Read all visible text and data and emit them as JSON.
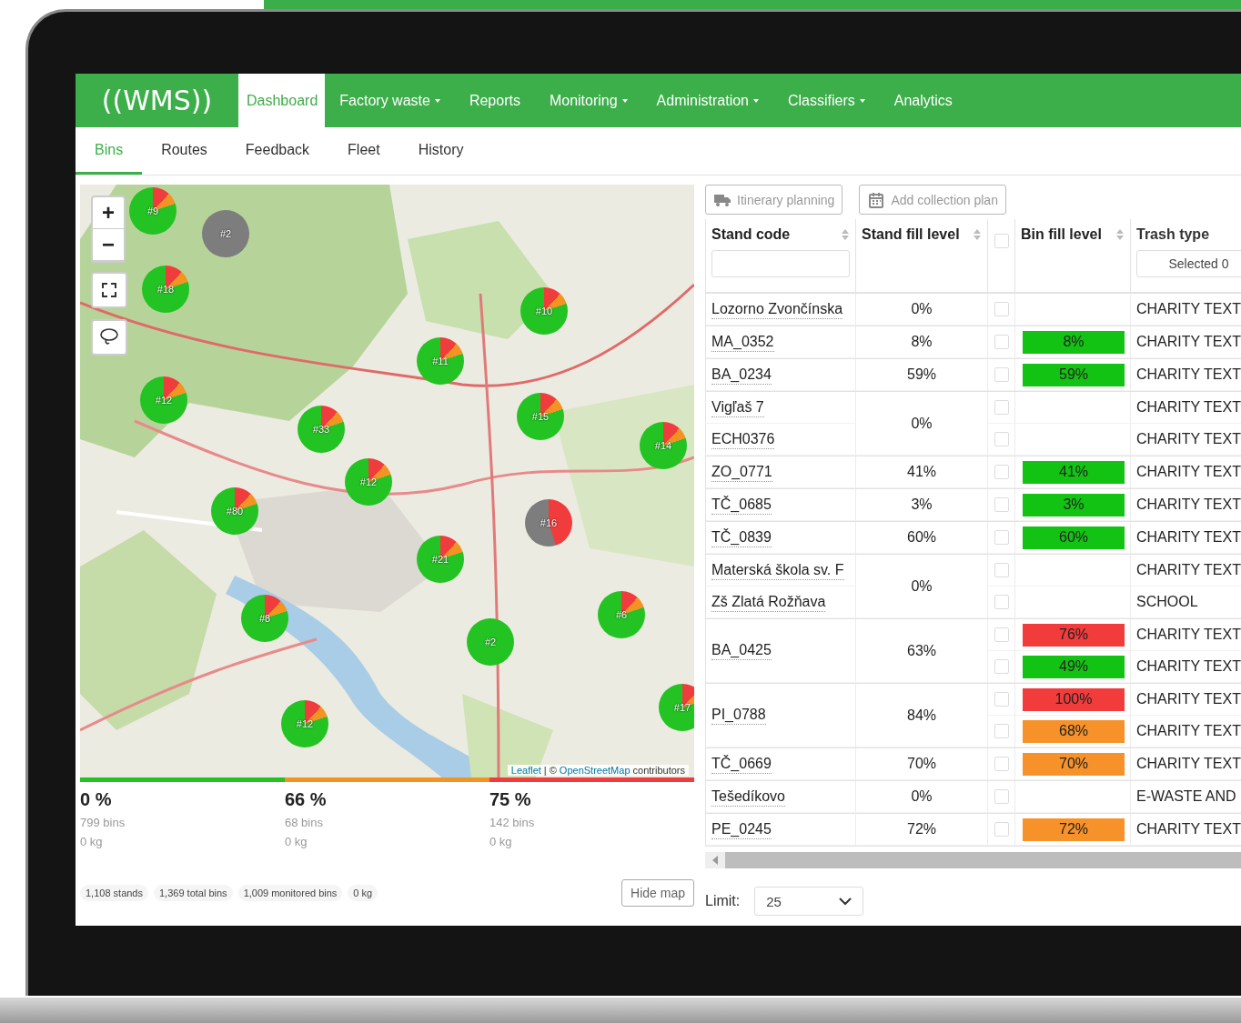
{
  "app": {
    "logo": "((WMS))"
  },
  "nav": [
    {
      "label": "Dashboard",
      "selected": true,
      "dropdown": false
    },
    {
      "label": "Factory waste",
      "selected": false,
      "dropdown": true
    },
    {
      "label": "Reports",
      "selected": false,
      "dropdown": false
    },
    {
      "label": "Monitoring",
      "selected": false,
      "dropdown": true
    },
    {
      "label": "Administration",
      "selected": false,
      "dropdown": true
    },
    {
      "label": "Classifiers",
      "selected": false,
      "dropdown": true
    },
    {
      "label": "Analytics",
      "selected": false,
      "dropdown": false
    }
  ],
  "subnav": [
    {
      "label": "Bins",
      "selected": true
    },
    {
      "label": "Routes",
      "selected": false
    },
    {
      "label": "Feedback",
      "selected": false
    },
    {
      "label": "Fleet",
      "selected": false
    },
    {
      "label": "History",
      "selected": false
    }
  ],
  "map": {
    "kind": "picture",
    "controls": [
      "+",
      "−"
    ],
    "markers": [
      {
        "label": "#9",
        "kind": "mixed"
      },
      {
        "label": "#2",
        "kind": "inactive"
      },
      {
        "label": "#18",
        "kind": "mixed"
      },
      {
        "label": "#10",
        "kind": "mixed"
      },
      {
        "label": "#11",
        "kind": "mixed"
      },
      {
        "label": "#12",
        "kind": "mixed"
      },
      {
        "label": "#33",
        "kind": "mixed"
      },
      {
        "label": "#15",
        "kind": "mixed"
      },
      {
        "label": "#14",
        "kind": "mixed"
      },
      {
        "label": "#12",
        "kind": "mixed"
      },
      {
        "label": "#80",
        "kind": "mixed"
      },
      {
        "label": "#16",
        "kind": "split"
      },
      {
        "label": "#21",
        "kind": "mixed"
      },
      {
        "label": "#6",
        "kind": "mixed"
      },
      {
        "label": "#8",
        "kind": "mixed"
      },
      {
        "label": "#2",
        "kind": "full"
      },
      {
        "label": "#17",
        "kind": "mixed"
      },
      {
        "label": "#12",
        "kind": "mixed"
      }
    ],
    "attribution": {
      "link_1": "Leaflet",
      "separator": "| ©",
      "link_2": "OpenStreetMap",
      "text": "contributors"
    }
  },
  "legend": [
    {
      "color": "#22c322",
      "percent": "0 %",
      "bins": "799 bins",
      "weight": "0 kg"
    },
    {
      "color": "#f39323",
      "percent": "66 %",
      "bins": "68 bins",
      "weight": "0 kg"
    },
    {
      "color": "#f03c3c",
      "percent": "75 %",
      "bins": "142 bins",
      "weight": "0 kg"
    }
  ],
  "summary": [
    "1,108 stands",
    "1,369 total bins",
    "1,009 monitored bins",
    "0 kg"
  ],
  "hide_map_button": "Hide map",
  "limit": {
    "label": "Limit:",
    "value": "25"
  },
  "toolbar": [
    {
      "label": "Itinerary planning",
      "disabled": true
    },
    {
      "label": "Add collection plan",
      "disabled": true
    }
  ],
  "table": {
    "columns": [
      {
        "label": "Stand code",
        "sortable": true
      },
      {
        "label": "Stand fill level",
        "sortable": true
      },
      {
        "kind": "checkbox",
        "checked": false
      },
      {
        "label": "Bin fill level",
        "sortable": true
      },
      {
        "label": "Trash type",
        "sortable": false
      }
    ],
    "trash_filter": "Selected 0",
    "stands": [
      {
        "codes": [
          "Lozorno Zvončínska"
        ],
        "fill": "0%",
        "bins": [
          {
            "checked": false,
            "trash": "CHARITY TEXT"
          }
        ]
      },
      {
        "codes": [
          "MA_0352"
        ],
        "fill": "8%",
        "bins": [
          {
            "checked": false,
            "level": "8%",
            "color": "#13c313",
            "trash": "CHARITY TEXT"
          }
        ]
      },
      {
        "codes": [
          "BA_0234"
        ],
        "fill": "59%",
        "bins": [
          {
            "checked": false,
            "level": "59%",
            "color": "#13c313",
            "trash": "CHARITY TEXT"
          }
        ]
      },
      {
        "codes": [
          "Vigľaš 7",
          "ECH0376"
        ],
        "fill": "0%",
        "bins": [
          {
            "checked": false,
            "trash": "CHARITY TEXT"
          },
          {
            "checked": false,
            "trash": "CHARITY TEXT"
          }
        ]
      },
      {
        "codes": [
          "ZO_0771"
        ],
        "fill": "41%",
        "bins": [
          {
            "checked": false,
            "level": "41%",
            "color": "#13c313",
            "trash": "CHARITY TEXT"
          }
        ]
      },
      {
        "codes": [
          "TČ_0685"
        ],
        "fill": "3%",
        "bins": [
          {
            "checked": false,
            "level": "3%",
            "color": "#13c313",
            "trash": "CHARITY TEXT"
          }
        ]
      },
      {
        "codes": [
          "TČ_0839"
        ],
        "fill": "60%",
        "bins": [
          {
            "checked": false,
            "level": "60%",
            "color": "#13c313",
            "trash": "CHARITY TEXT"
          }
        ]
      },
      {
        "codes": [
          "Materská škola sv. F",
          "Zš Zlatá Rožňava"
        ],
        "fill": "0%",
        "bins": [
          {
            "checked": false,
            "trash": "CHARITY TEXT"
          },
          {
            "checked": false,
            "trash": "SCHOOL"
          }
        ]
      },
      {
        "codes": [
          "BA_0425"
        ],
        "fill": "63%",
        "bins": [
          {
            "checked": false,
            "level": "76%",
            "color": "#f23b3b",
            "trash": "CHARITY TEXT"
          },
          {
            "checked": false,
            "level": "49%",
            "color": "#13c313",
            "trash": "CHARITY TEXT"
          }
        ]
      },
      {
        "codes": [
          "PI_0788"
        ],
        "fill": "84%",
        "bins": [
          {
            "checked": false,
            "level": "100%",
            "color": "#f23b3b",
            "trash": "CHARITY TEXT"
          },
          {
            "checked": false,
            "level": "68%",
            "color": "#f7922a",
            "trash": "CHARITY TEXT"
          }
        ]
      },
      {
        "codes": [
          "TČ_0669"
        ],
        "fill": "70%",
        "bins": [
          {
            "checked": false,
            "level": "70%",
            "color": "#f7922a",
            "trash": "CHARITY TEXT"
          }
        ]
      },
      {
        "codes": [
          "Tešedíkovo"
        ],
        "fill": "0%",
        "bins": [
          {
            "checked": false,
            "trash": "E-WASTE AND"
          }
        ]
      },
      {
        "codes": [
          "PE_0245"
        ],
        "fill": "72%",
        "bins": [
          {
            "checked": false,
            "level": "72%",
            "color": "#f7922a",
            "trash": "CHARITY TEXT"
          }
        ]
      }
    ]
  }
}
